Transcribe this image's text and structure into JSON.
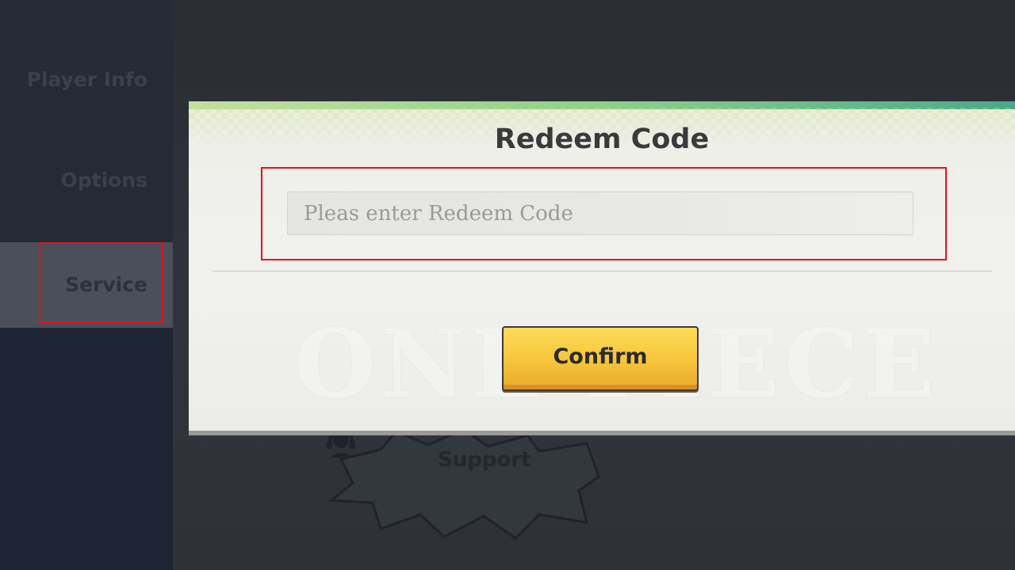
{
  "sidebar": {
    "items": [
      {
        "label": "Player Info"
      },
      {
        "label": "Options"
      },
      {
        "label": "Service"
      }
    ]
  },
  "background": {
    "support_label": "Support"
  },
  "modal": {
    "title": "Redeem Code",
    "watermark": "ONE PIECE",
    "input": {
      "placeholder": "Pleas enter Redeem Code",
      "value": ""
    },
    "confirm_label": "Confirm"
  },
  "colors": {
    "highlight": "#e0141c",
    "confirm_button": "#f6c43a",
    "modal_accent": "#8fd08a"
  },
  "icons": {
    "support": "headset-icon"
  }
}
